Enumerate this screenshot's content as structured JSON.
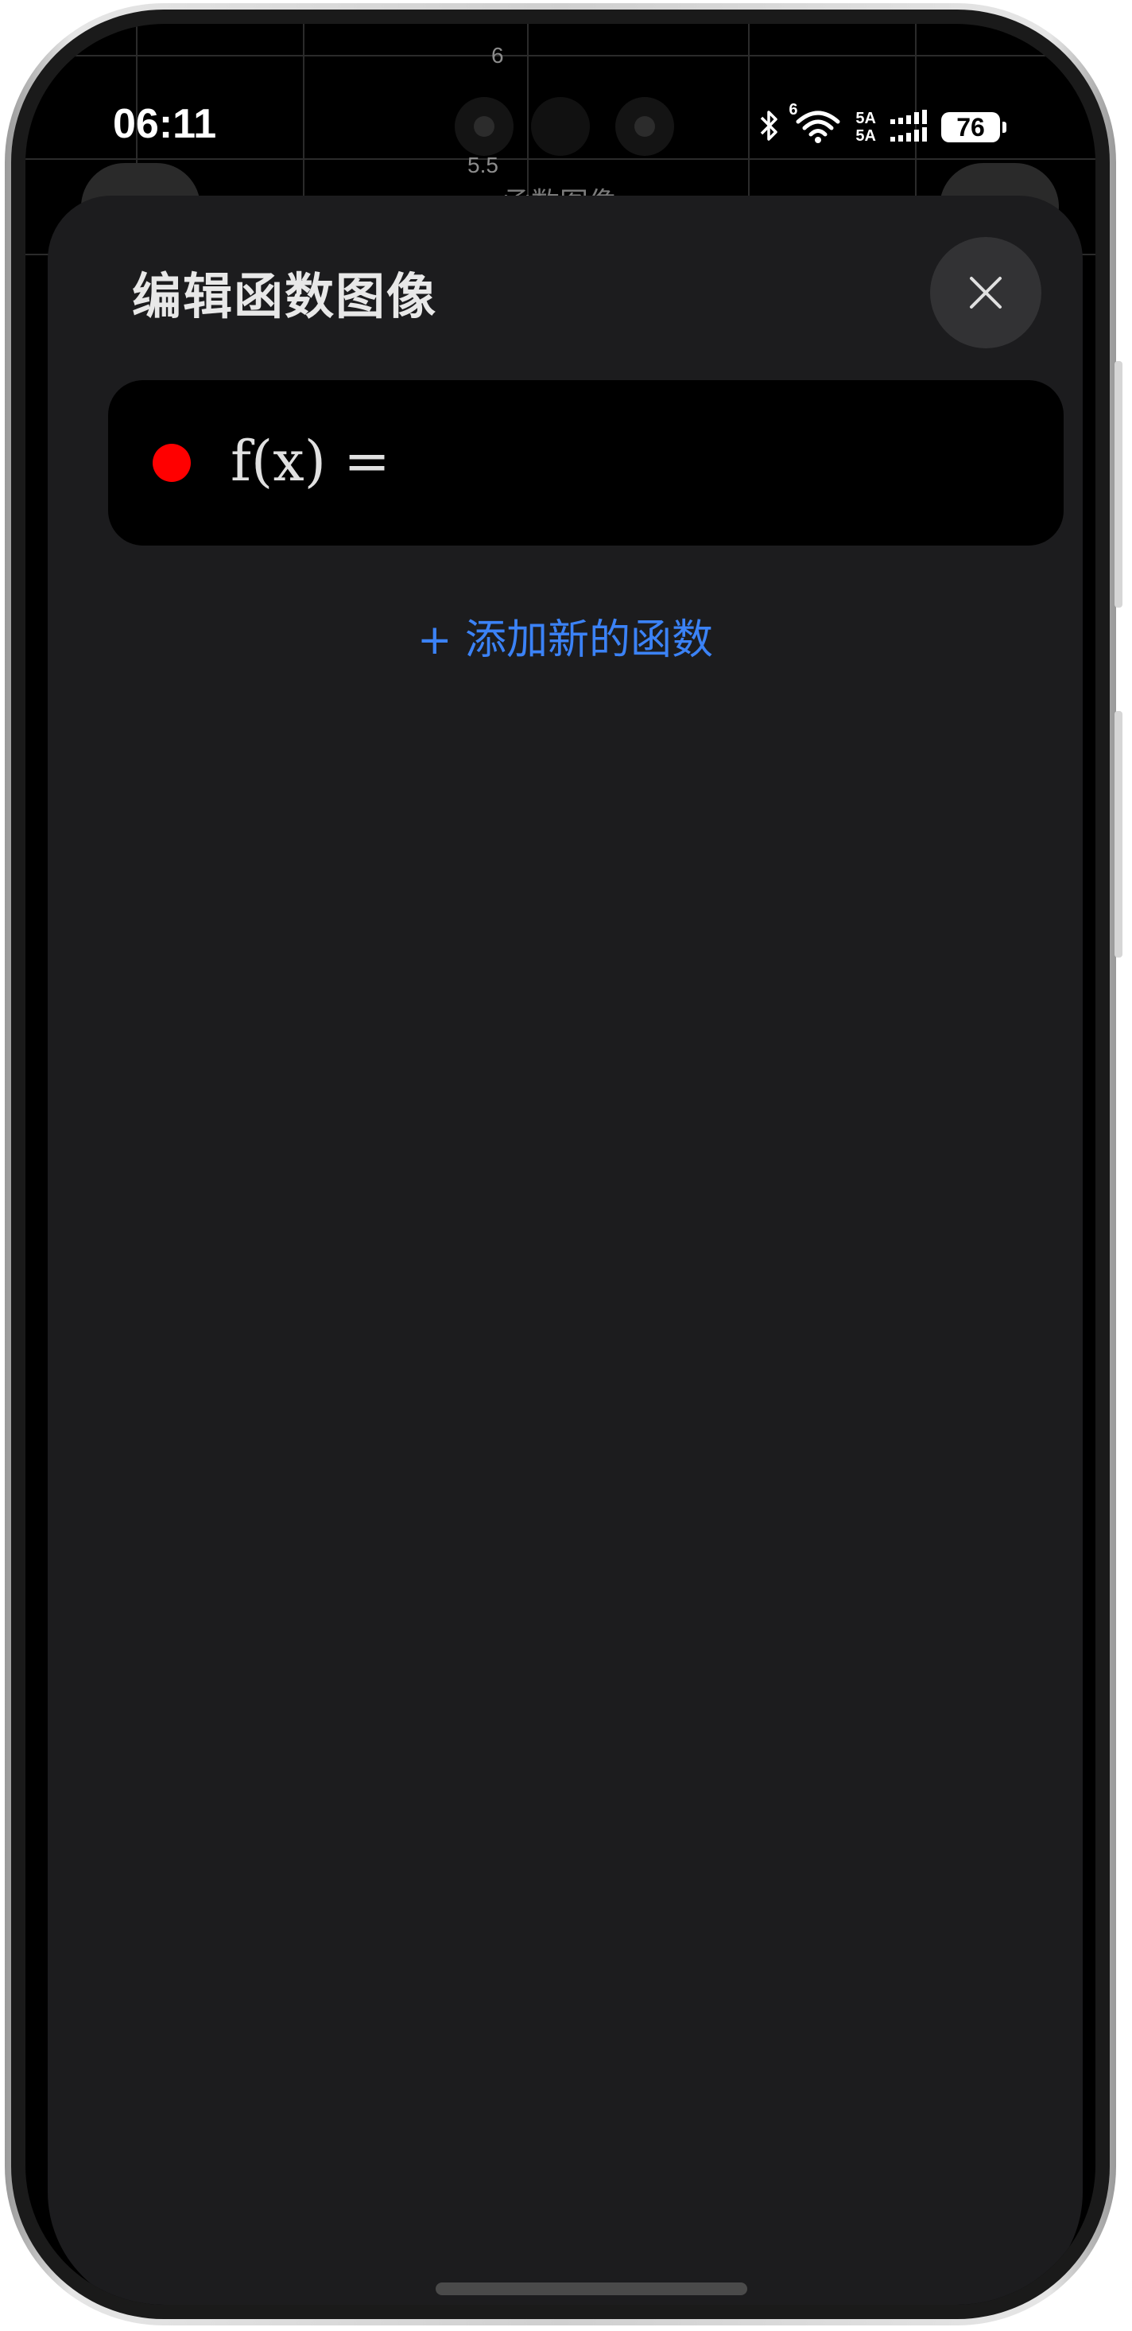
{
  "status_bar": {
    "time": "06:11",
    "network_top": "5A",
    "network_bottom": "5A",
    "wifi_badge": "6",
    "battery": "76",
    "icons": [
      "bluetooth-icon",
      "wifi-icon",
      "signal-icon",
      "battery-icon"
    ]
  },
  "background_app": {
    "title_fragment": "函数图像",
    "y_ticks": [
      "6",
      "5.5"
    ]
  },
  "sheet": {
    "title": "编辑函数图像",
    "close_icon": "close-icon",
    "functions": [
      {
        "label": "f(x) =",
        "value": "",
        "color": "#ff0000"
      }
    ],
    "add_button_label": "+ 添加新的函数",
    "accent_color": "#3b82f6"
  }
}
